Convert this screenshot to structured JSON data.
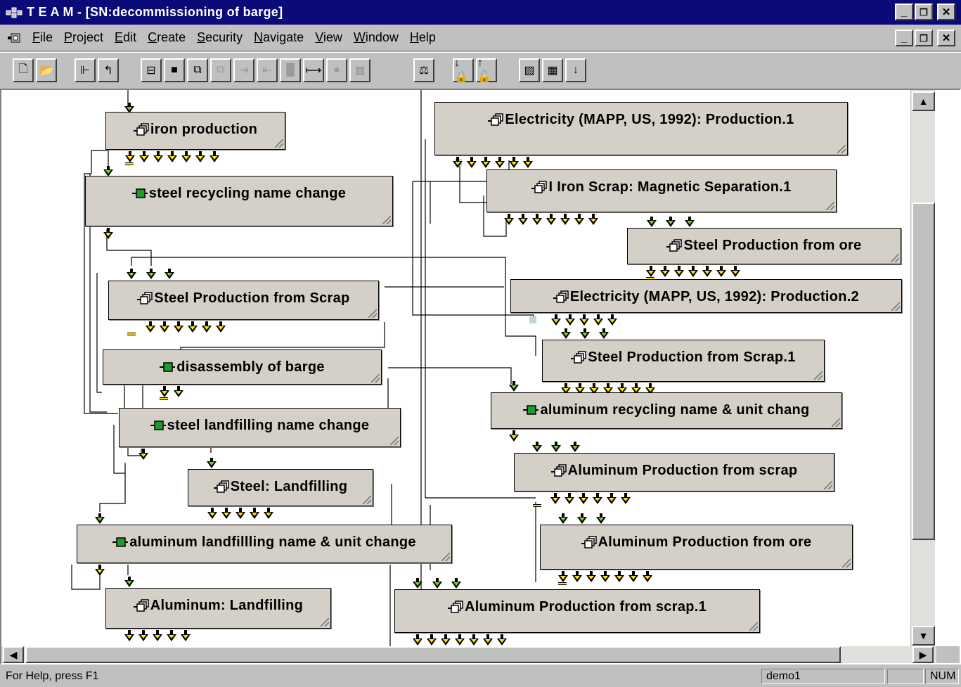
{
  "window": {
    "title": "T E A M - [SN:decommissioning of barge]",
    "minimize": "_",
    "maximize": "▫",
    "close": "×"
  },
  "menu": {
    "items": [
      {
        "label": "File",
        "u": "F",
        "rest": "ile"
      },
      {
        "label": "Project",
        "u": "P",
        "rest": "roject"
      },
      {
        "label": "Edit",
        "u": "E",
        "rest": "dit"
      },
      {
        "label": "Create",
        "u": "C",
        "rest": "reate"
      },
      {
        "label": "Security",
        "u": "S",
        "rest": "ecurity"
      },
      {
        "label": "Navigate",
        "u": "N",
        "rest": "avigate"
      },
      {
        "label": "View",
        "u": "V",
        "rest": "iew"
      },
      {
        "label": "Window",
        "u": "W",
        "rest": "indow"
      },
      {
        "label": "Help",
        "u": "H",
        "rest": "elp"
      }
    ]
  },
  "toolbar": {
    "buttons": [
      {
        "icon": "new-document-icon",
        "glyph": "🗋",
        "enabled": true
      },
      {
        "icon": "open-folder-icon",
        "glyph": "📂",
        "enabled": true
      },
      {
        "icon": "tree-view-icon",
        "glyph": "⊩",
        "enabled": true
      },
      {
        "icon": "up-level-icon",
        "glyph": "↰",
        "enabled": true
      },
      {
        "icon": "module-icon",
        "glyph": "⊟",
        "enabled": true
      },
      {
        "icon": "green-module-icon",
        "glyph": "■",
        "enabled": true
      },
      {
        "icon": "process-icon",
        "glyph": "⧉",
        "enabled": true
      },
      {
        "icon": "process-copy-icon",
        "glyph": "⧉",
        "enabled": false
      },
      {
        "icon": "link-in-icon",
        "glyph": "⇥",
        "enabled": false
      },
      {
        "icon": "link-out-icon",
        "glyph": "⇤",
        "enabled": false
      },
      {
        "icon": "block-icon",
        "glyph": "█",
        "enabled": false
      },
      {
        "icon": "span-icon",
        "glyph": "⟼",
        "enabled": true
      },
      {
        "icon": "node-icon",
        "glyph": "●",
        "enabled": false
      },
      {
        "icon": "binary-icon",
        "glyph": "▦",
        "enabled": false
      },
      {
        "icon": "balance-icon",
        "glyph": "⚖",
        "enabled": true
      },
      {
        "icon": "lock-down-icon",
        "glyph": "↓🔒",
        "enabled": true
      },
      {
        "icon": "lock-up-icon",
        "glyph": "↑🔓",
        "enabled": true
      },
      {
        "icon": "chart-icon",
        "glyph": "▨",
        "enabled": true
      },
      {
        "icon": "table-icon",
        "glyph": "▦",
        "enabled": true
      },
      {
        "icon": "down-arrow-icon",
        "glyph": "↓",
        "enabled": true
      }
    ]
  },
  "nodes": [
    {
      "id": "iron-production",
      "label": "iron production",
      "kind": "process"
    },
    {
      "id": "steel-recycling",
      "label": "steel recycling name change",
      "kind": "module"
    },
    {
      "id": "steel-prod-scrap",
      "label": "Steel Production from Scrap",
      "kind": "process"
    },
    {
      "id": "disassembly",
      "label": "disassembly of barge",
      "kind": "module"
    },
    {
      "id": "steel-landfill-name",
      "label": "steel landfilling name change",
      "kind": "module"
    },
    {
      "id": "steel-landfilling",
      "label": "Steel: Landfilling",
      "kind": "process"
    },
    {
      "id": "alu-landfill-name",
      "label": "aluminum landfillling name & unit change",
      "kind": "module"
    },
    {
      "id": "alu-landfilling",
      "label": "Aluminum: Landfilling",
      "kind": "process"
    },
    {
      "id": "electricity-1",
      "label": "Electricity (MAPP, US, 1992): Production.1",
      "kind": "process"
    },
    {
      "id": "iron-scrap-mag",
      "label": "I Iron Scrap: Magnetic Separation.1",
      "kind": "process"
    },
    {
      "id": "steel-prod-ore",
      "label": "Steel Production from ore",
      "kind": "process"
    },
    {
      "id": "electricity-2",
      "label": "Electricity (MAPP, US, 1992): Production.2",
      "kind": "process"
    },
    {
      "id": "steel-prod-scrap-1",
      "label": "Steel Production from Scrap.1",
      "kind": "process"
    },
    {
      "id": "alu-recycling",
      "label": "aluminum recycling name & unit chang",
      "kind": "module"
    },
    {
      "id": "alu-prod-scrap",
      "label": "Aluminum Production from scrap",
      "kind": "process"
    },
    {
      "id": "alu-prod-ore",
      "label": "Aluminum Production from ore",
      "kind": "process"
    },
    {
      "id": "alu-prod-scrap-1",
      "label": "Aluminum Production from scrap.1",
      "kind": "process"
    }
  ],
  "status": {
    "help": "For Help, press F1",
    "user": "demo1",
    "num": "NUM"
  }
}
